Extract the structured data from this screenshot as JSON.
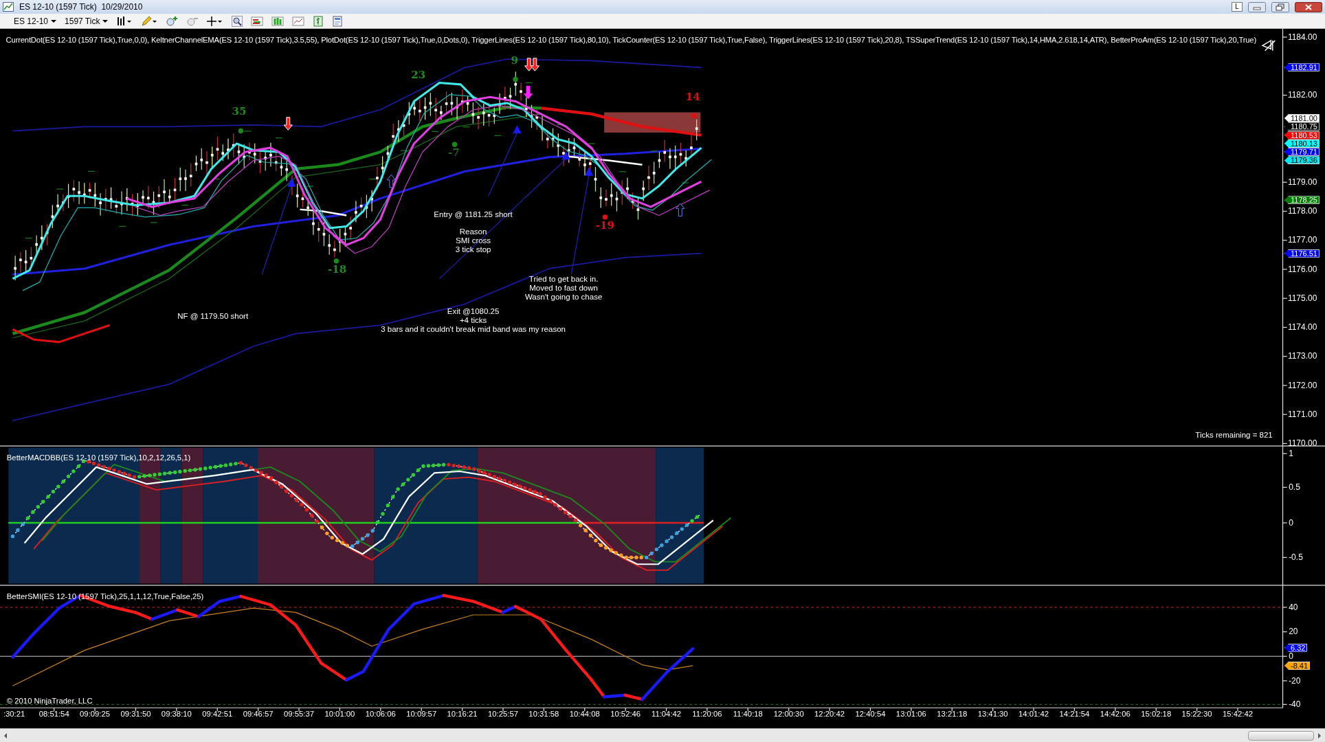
{
  "window": {
    "title": "ES 12-10 (1597 Tick)  10/29/2010",
    "lock_button": "L"
  },
  "toolbar": {
    "instrument": "ES 12-10",
    "period": "1597 Tick"
  },
  "price_panel": {
    "indicators_label": "CurrentDot(ES 12-10 (1597 Tick),True,0,0), KeltnerChannelEMA(ES 12-10 (1597 Tick),3.5,55), PlotDot(ES 12-10 (1597 Tick),True,0,Dots,0), TriggerLines(ES 12-10 (1597 Tick),80,10), TickCounter(ES 12-10 (1597 Tick),True,False), TriggerLines(ES 12-10 (1597 Tick),20,8), TSSuperTrend(ES 12-10 (1597 Tick),14,HMA,2.618,14,ATR), BetterProAm(ES 12-10 (1597 Tick),20,True)",
    "axis_ticks": [
      "1184.00",
      "1182.00",
      "1179.00",
      "1178.00",
      "1177.00",
      "1176.00",
      "1175.00",
      "1174.00",
      "1173.00",
      "1172.00",
      "1171.00",
      "1170.00"
    ],
    "price_markers": [
      {
        "text": "1182.91",
        "color": "#0000ff"
      },
      {
        "text": "1181.00",
        "color": "#ffffff"
      },
      {
        "text": "1180.75",
        "color": "#000000"
      },
      {
        "text": "1180.53",
        "color": "#ff0000"
      },
      {
        "text": "1180.13",
        "color": "#00ffff"
      },
      {
        "text": "1179.71",
        "color": "#0000ff"
      },
      {
        "text": "1179.36",
        "color": "#00e5ee"
      },
      {
        "text": "1178.25",
        "color": "#008000"
      },
      {
        "text": "1176.51",
        "color": "#0000ff"
      }
    ],
    "bar_labels": [
      {
        "text": "35",
        "color": "#1e8c1e"
      },
      {
        "text": "23",
        "color": "#1e8c1e"
      },
      {
        "text": "9",
        "color": "#1e8c1e"
      },
      {
        "text": "14",
        "color": "#e01010"
      },
      {
        "text": "-7",
        "color": "#1f6a1f"
      },
      {
        "text": "-18",
        "color": "#1e8c1e"
      },
      {
        "text": "-19",
        "color": "#e01010"
      }
    ],
    "notes": [
      {
        "lines": [
          "Entry @ 1181.25 short"
        ]
      },
      {
        "lines": [
          "Reason",
          "SMI cross",
          "3 tick stop"
        ]
      },
      {
        "lines": [
          "Tried to get back in.",
          "Moved to fast down",
          "Wasn't going to chase"
        ]
      },
      {
        "lines": [
          "NF @ 1179.50 short"
        ]
      },
      {
        "lines": [
          "Exit @1080.25",
          "+4 ticks",
          "3 bars and it couldn't break mid band was my reason"
        ]
      }
    ],
    "ticks_remaining": "Ticks remaining = 821"
  },
  "macd_panel": {
    "label": "BetterMACDBB(ES 12-10 (1597 Tick),10,2,12,26,5,1)",
    "axis_ticks": [
      "1",
      "0.5",
      "0",
      "-0.5"
    ]
  },
  "smi_panel": {
    "label": "BetterSMI(ES 12-10 (1597 Tick),25,1,1,12,True,False,25)",
    "axis_ticks": [
      "40",
      "20",
      "0",
      "-20",
      "-40"
    ],
    "value_markers": [
      {
        "text": "6.32",
        "color": "#0000ff"
      },
      {
        "text": "-8.41",
        "color": "#ffa500"
      }
    ]
  },
  "copyright": "© 2010 NinjaTrader, LLC",
  "time_axis": [
    ":30:21",
    "08:51:54",
    "09:09:25",
    "09:31:50",
    "09:38:10",
    "09:42:51",
    "09:46:57",
    "09:55:37",
    "10:01:00",
    "10:06:06",
    "10:09:57",
    "10:16:21",
    "10:25:57",
    "10:31:58",
    "10:44:08",
    "10:52:46",
    "11:04:42",
    "11:20:06",
    "11:40:18",
    "12:00:30",
    "12:20:42",
    "12:40:54",
    "13:01:06",
    "13:21:18",
    "13:41:30",
    "14:01:42",
    "14:21:54",
    "14:42:06",
    "15:02:18",
    "15:22:30",
    "15:42:42"
  ]
}
